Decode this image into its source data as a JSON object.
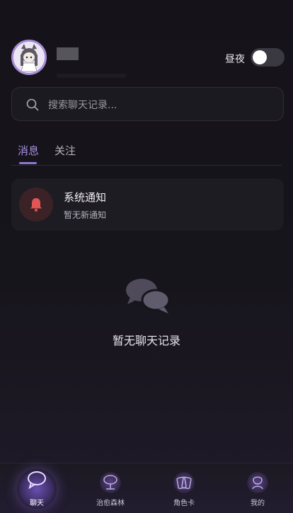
{
  "header": {
    "daynight_label": "昼夜",
    "toggle_on": false
  },
  "search": {
    "placeholder": "搜索聊天记录..."
  },
  "tabs": [
    {
      "label": "消息",
      "active": true
    },
    {
      "label": "关注",
      "active": false
    }
  ],
  "notification": {
    "title": "系统通知",
    "subtitle": "暂无新通知",
    "icon": "bell-icon"
  },
  "empty_state": {
    "icon": "chat-bubbles-icon",
    "text": "暂无聊天记录"
  },
  "bottom_nav": [
    {
      "label": "聊天",
      "icon": "chat-icon",
      "active": true
    },
    {
      "label": "治愈森林",
      "icon": "forest-icon",
      "active": false
    },
    {
      "label": "角色卡",
      "icon": "cards-icon",
      "active": false
    },
    {
      "label": "我的",
      "icon": "profile-icon",
      "active": false
    }
  ],
  "colors": {
    "accent": "#8f74d4",
    "bell": "#e25555",
    "background": "#151319"
  }
}
